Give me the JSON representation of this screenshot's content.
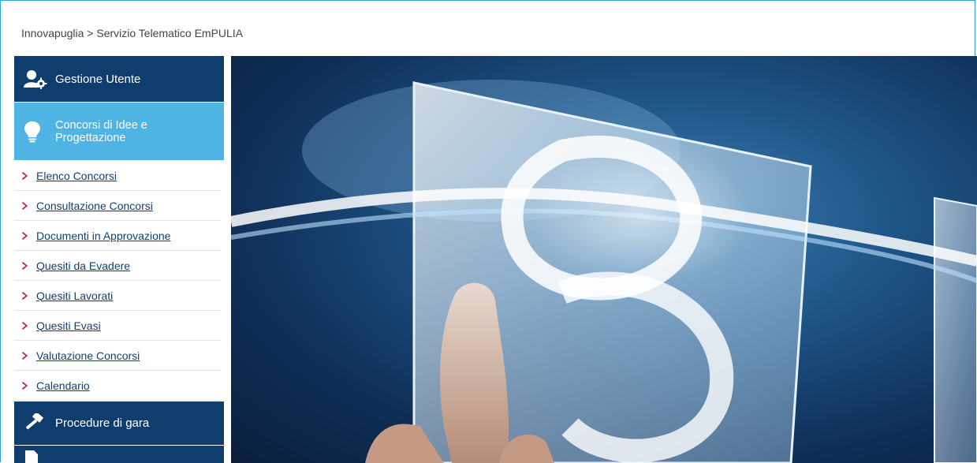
{
  "breadcrumb": {
    "text": "Innovapuglia > Servizio Telematico EmPULIA"
  },
  "sidebar": {
    "sections": {
      "gestione_utente": {
        "label": "Gestione Utente",
        "icon": "user-gear-icon"
      },
      "concorsi": {
        "label_line1": "Concorsi di Idee e",
        "label_line2": "Progettazione",
        "icon": "lightbulb-icon"
      },
      "procedure": {
        "label": "Procedure di gara",
        "icon": "gavel-icon"
      },
      "next": {
        "label": "",
        "icon": "document-icon"
      }
    },
    "items": [
      {
        "label": "Elenco Concorsi"
      },
      {
        "label": "Consultazione Concorsi"
      },
      {
        "label": "Documenti in Approvazione"
      },
      {
        "label": "Quesiti da Evadere"
      },
      {
        "label": "Quesiti Lavorati"
      },
      {
        "label": "Quesiti Evasi"
      },
      {
        "label": "Valutazione Concorsi"
      },
      {
        "label": "Calendario"
      }
    ]
  },
  "colors": {
    "section_dark": "#0f3d6e",
    "section_active": "#4fb3e3",
    "chevron": "#c0136a",
    "link": "#123f73",
    "frame_border": "#2aa0d6"
  },
  "hero": {
    "image": "hand-touching-glass-panels-image"
  }
}
